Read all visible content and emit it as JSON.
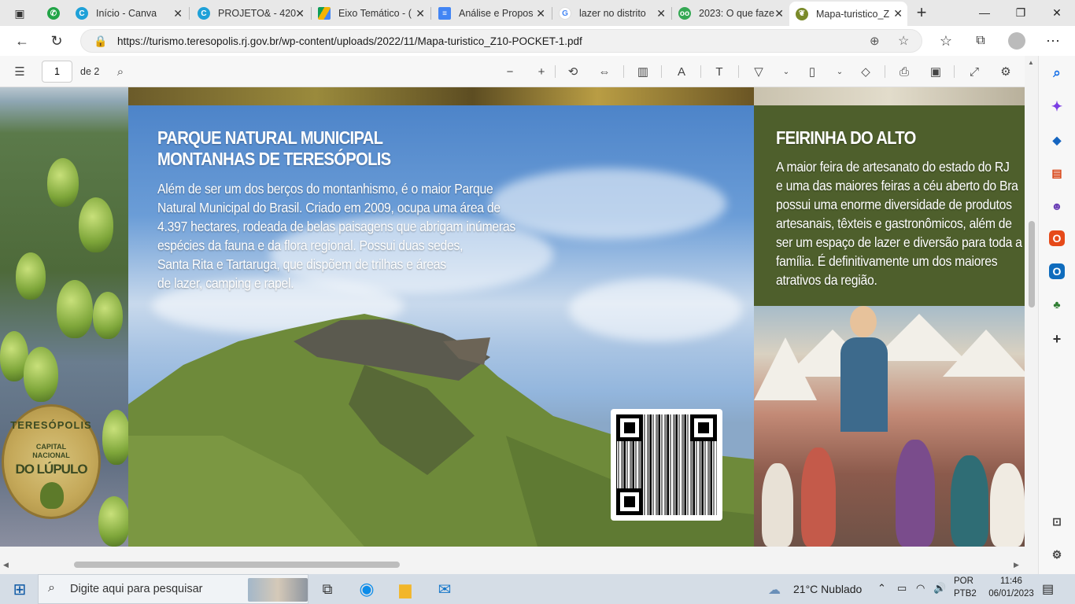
{
  "browser": {
    "tabs": [
      {
        "title": "Início - Canva",
        "icon": "canva-icon",
        "color": "#1fa1d8"
      },
      {
        "title": "PROJETO& - 420",
        "icon": "canva-icon",
        "color": "#1fa1d8"
      },
      {
        "title": "Eixo Temático - (",
        "icon": "google-drive-icon",
        "color": "#f4b400"
      },
      {
        "title": "Análise e Propos",
        "icon": "google-docs-icon",
        "color": "#4285f4"
      },
      {
        "title": "lazer no distrito",
        "icon": "google-icon",
        "color": "#4285f4"
      },
      {
        "title": "2023: O que faze",
        "icon": "tripadvisor-icon",
        "color": "#34a853"
      },
      {
        "title": "Mapa-turistico_Z",
        "icon": "hop-leaf-icon",
        "color": "#7a8a2a",
        "active": true
      }
    ],
    "new_tab_symbol": "+",
    "url": "https://turismo.teresopolis.rj.gov.br/wp-content/uploads/2022/11/Mapa-turistico_Z10-POCKET-1.pdf",
    "window_controls": {
      "minimize": "—",
      "restore": "❐",
      "close": "✕"
    }
  },
  "pdf_toolbar": {
    "page_number": "1",
    "page_total": "de 2"
  },
  "document": {
    "parque": {
      "title_line1": "PARQUE NATURAL MUNICIPAL",
      "title_line2": "MONTANHAS DE TERESÓPOLIS",
      "body": "Além de ser um dos berços do montanhismo, é o maior Parque\nNatural Municipal do Brasil. Criado em 2009, ocupa uma área de\n4.397 hectares, rodeada de belas paisagens que abrigam inúmeras\nespécies da fauna e da flora regional. Possui duas sedes,\nSanta Rita e Tartaruga, que dispõem de trilhas e áreas\nde lazer, camping e rapel."
    },
    "feirinha": {
      "title": "FEIRINHA DO ALTO",
      "body": "A maior feira de artesanato do estado do RJ\ne uma das maiores feiras a céu aberto do Bra\npossui uma enorme diversidade de produtos\nartesanais, têxteis e gastronômicos, além de\nser um espaço de lazer e diversão para toda a\nfamília. É definitivamente um dos maiores\natrativos da região."
    },
    "seal": {
      "line1": "TERESÓPOLIS",
      "line2": "CAPITAL",
      "line3": "NACIONAL",
      "line4": "DO LÚPULO"
    }
  },
  "taskbar": {
    "search_placeholder": "Digite aqui para pesquisar",
    "weather": "21°C  Nublado",
    "language": "POR",
    "layout": "PTB2",
    "time": "11:46",
    "date": "06/01/2023"
  }
}
